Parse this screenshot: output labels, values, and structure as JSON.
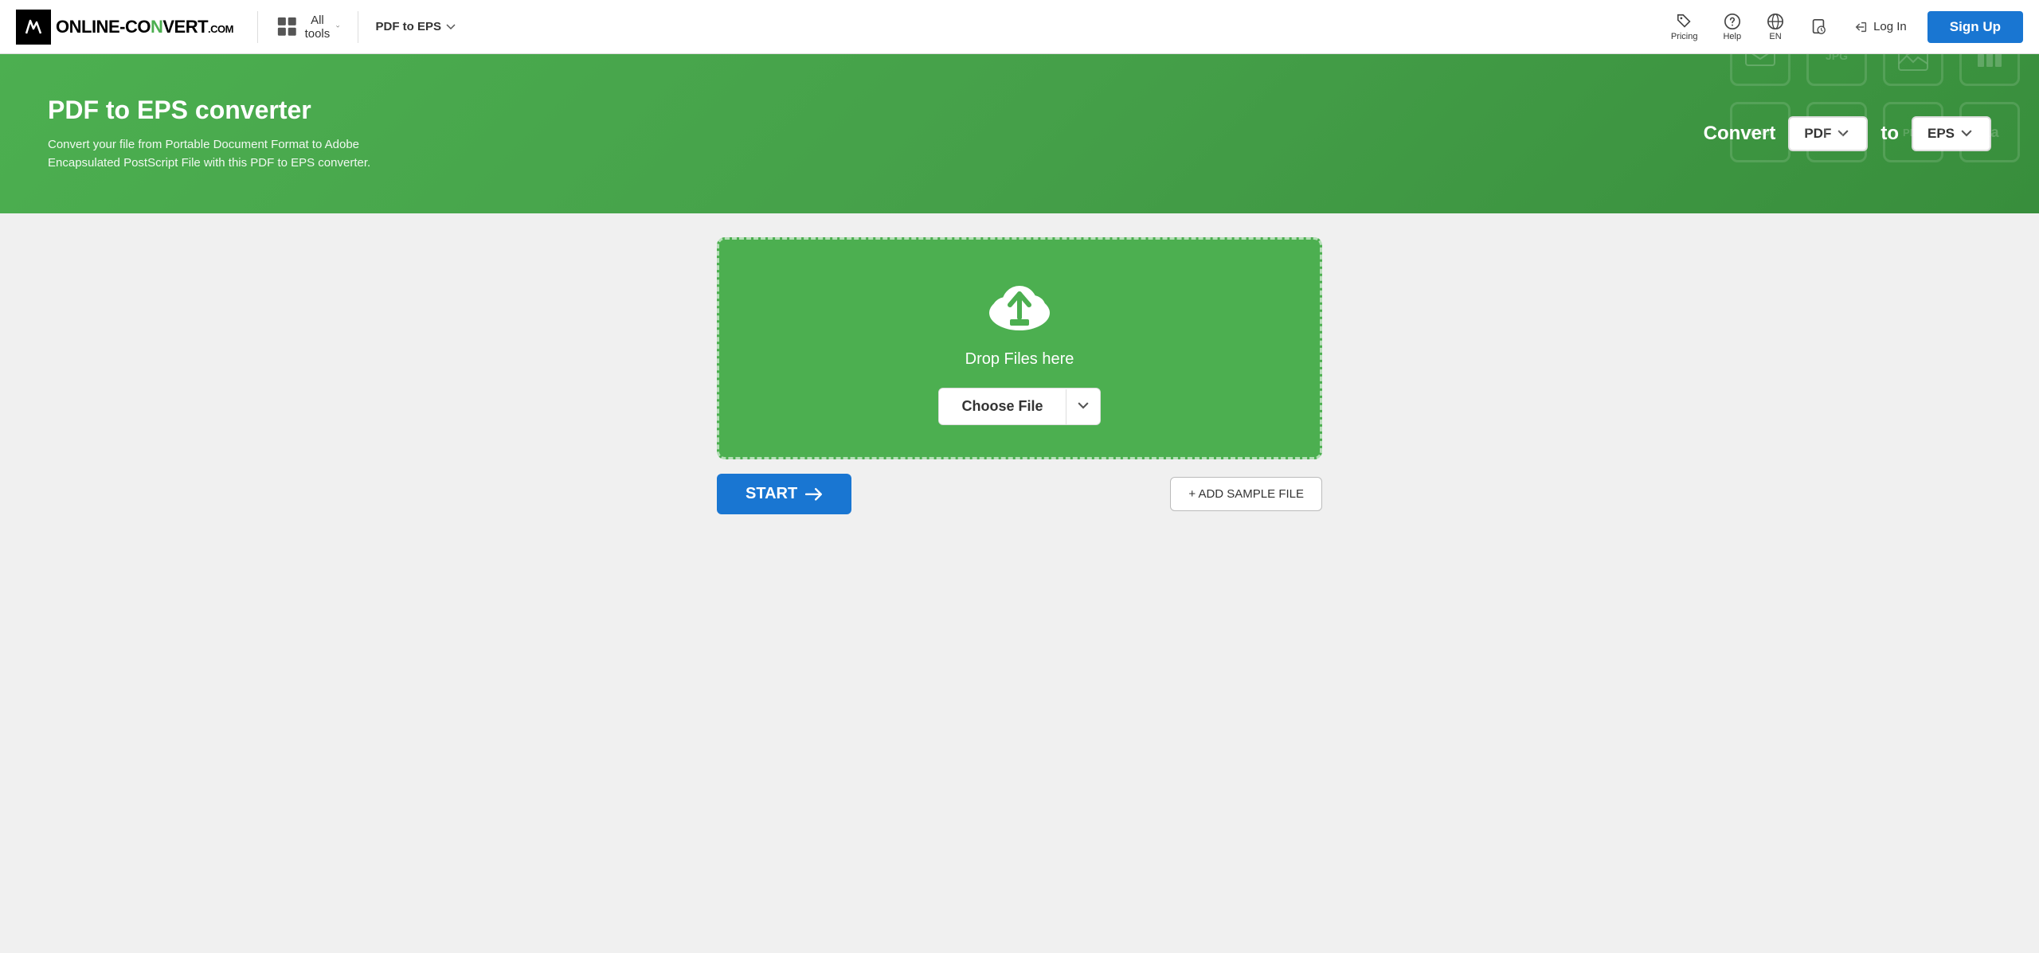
{
  "header": {
    "logo_text_part1": "ONLINE-CO",
    "logo_text_highlight": "N",
    "logo_text_part2": "VERT",
    "logo_text_suffix": ".COM",
    "all_tools_label": "All tools",
    "converter_label": "PDF to EPS",
    "pricing_label": "Pricing",
    "help_label": "Help",
    "lang_label": "EN",
    "history_label": "",
    "login_label": "Log In",
    "signup_label": "Sign Up"
  },
  "hero": {
    "title": "PDF to EPS converter",
    "description": "Convert your file from Portable Document Format to Adobe Encapsulated PostScript File with this PDF to EPS converter.",
    "convert_label": "Convert",
    "from_format": "PDF",
    "to_label": "to",
    "to_format": "EPS"
  },
  "dropzone": {
    "drop_text": "Drop Files here",
    "choose_file_label": "Choose File",
    "chevron_label": "▾"
  },
  "actions": {
    "start_label": "START",
    "add_sample_label": "+ ADD SAMPLE FILE"
  },
  "bg_icons": [
    "JPG",
    "PNG",
    "PDF",
    "",
    "",
    "",
    "",
    "",
    "",
    "",
    "",
    ""
  ]
}
